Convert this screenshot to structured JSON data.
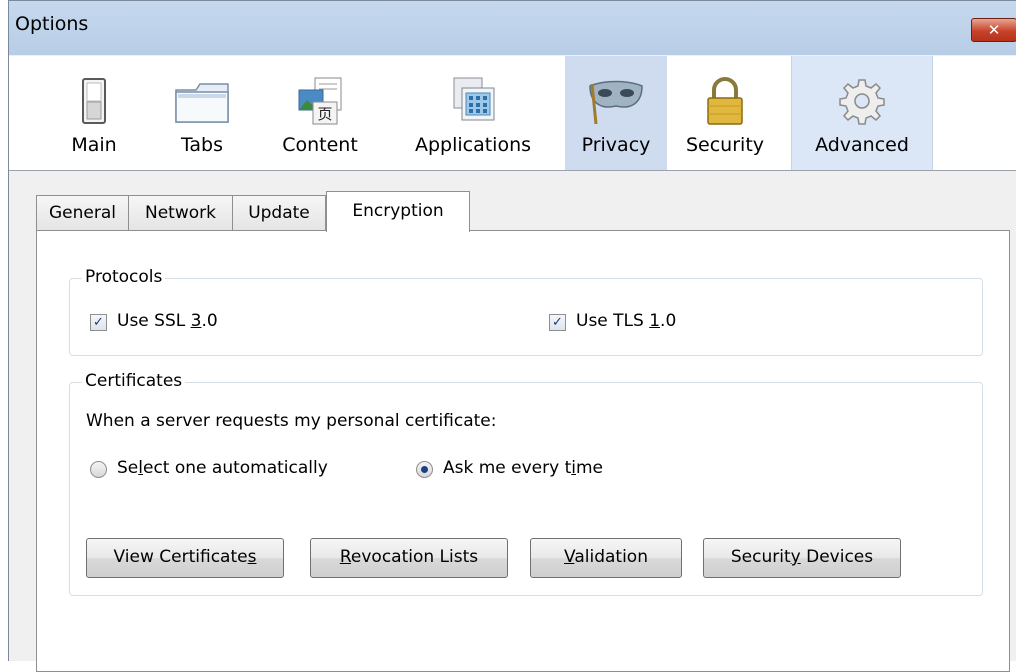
{
  "window": {
    "title": "Options",
    "close_glyph": "✕"
  },
  "toolbar": {
    "panes": [
      {
        "label": "Main",
        "icon": "switch-icon"
      },
      {
        "label": "Tabs",
        "icon": "folder-tab-icon"
      },
      {
        "label": "Content",
        "icon": "content-icon"
      },
      {
        "label": "Applications",
        "icon": "applications-icon"
      },
      {
        "label": "Privacy",
        "icon": "mask-icon"
      },
      {
        "label": "Security",
        "icon": "padlock-icon"
      },
      {
        "label": "Advanced",
        "icon": "gear-icon"
      }
    ],
    "selected": "Advanced"
  },
  "tabs": [
    {
      "label": "General"
    },
    {
      "label": "Network"
    },
    {
      "label": "Update"
    },
    {
      "label": "Encryption"
    }
  ],
  "active_tab": "Encryption",
  "protocols": {
    "title": "Protocols",
    "ssl": {
      "label_pre": "Use SSL ",
      "label_key": "3",
      "label_post": ".0",
      "checked": true
    },
    "tls": {
      "label_pre": "Use TLS ",
      "label_key": "1",
      "label_post": ".0",
      "checked": true
    }
  },
  "certificates": {
    "title": "Certificates",
    "prompt": "When a server requests my personal certificate:",
    "auto": {
      "label_pre": "Se",
      "label_key": "l",
      "label_post": "ect one automatically",
      "selected": false
    },
    "ask": {
      "label_pre": "Ask me every t",
      "label_key": "i",
      "label_post": "me",
      "selected": true
    },
    "buttons": {
      "view": {
        "pre": "View Certificate",
        "key": "s",
        "post": ""
      },
      "revocation": {
        "pre": "",
        "key": "R",
        "post": "evocation Lists"
      },
      "validation": {
        "pre": "",
        "key": "V",
        "post": "alidation"
      },
      "devices": {
        "pre": "Securit",
        "key": "y",
        "post": " Devices"
      }
    }
  }
}
